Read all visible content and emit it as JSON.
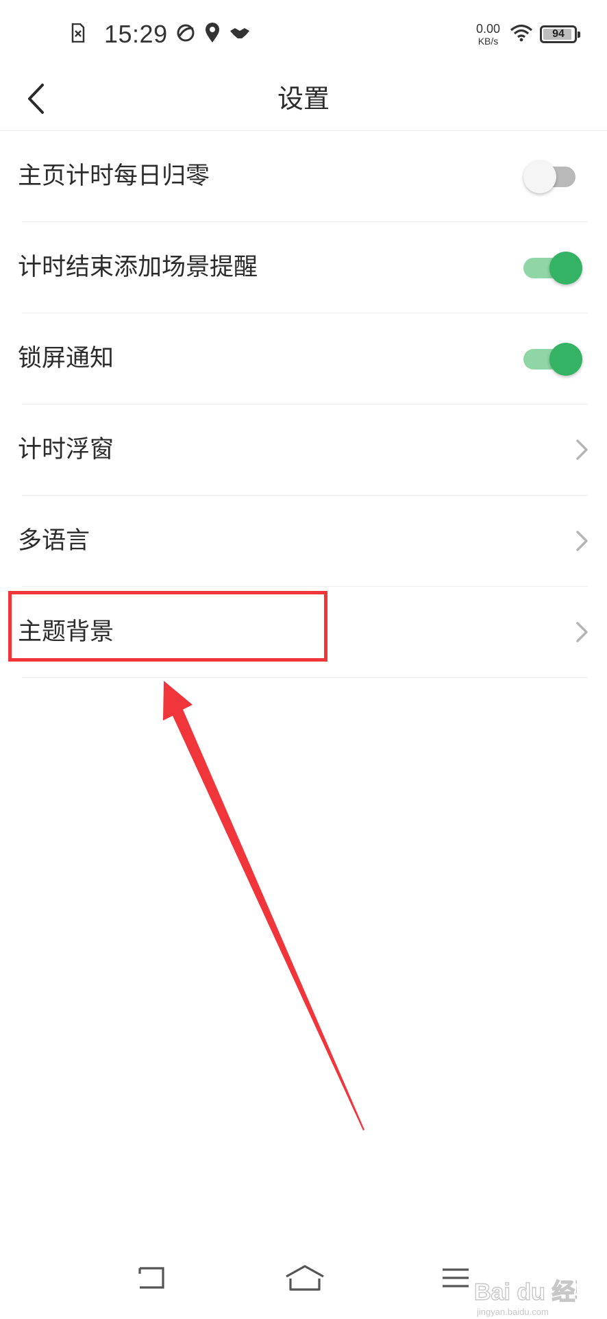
{
  "status_bar": {
    "time": "15:29",
    "net_speed_value": "0.00",
    "net_speed_unit": "KB/s",
    "battery_level": "94",
    "battery_percent": 94
  },
  "header": {
    "title": "设置"
  },
  "settings": {
    "items": [
      {
        "label": "主页计时每日归零",
        "control": "toggle",
        "enabled": false
      },
      {
        "label": "计时结束添加场景提醒",
        "control": "toggle",
        "enabled": true
      },
      {
        "label": "锁屏通知",
        "control": "toggle",
        "enabled": true
      },
      {
        "label": "计时浮窗",
        "control": "chevron"
      },
      {
        "label": "多语言",
        "control": "chevron"
      },
      {
        "label": "主题背景",
        "control": "chevron"
      }
    ]
  },
  "colors": {
    "toggle_on_knob": "#33b363",
    "toggle_on_track": "#8fd5a6",
    "annotation_red": "#f0353b"
  },
  "watermark": {
    "brand": "Bai du 经验",
    "url": "jingyan.baidu.com"
  }
}
